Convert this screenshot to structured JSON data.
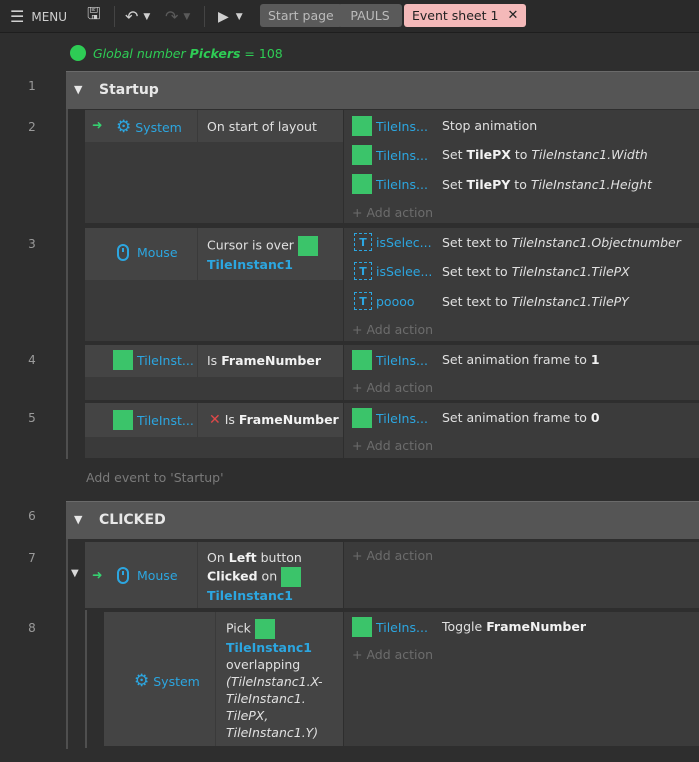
{
  "toolbar": {
    "menu": "MENU",
    "tabs": [
      "Start page",
      "PAULS",
      "Event sheet 1"
    ]
  },
  "global_var": {
    "prefix": "Global number",
    "name": "Pickers",
    "value": "= 108"
  },
  "rows": [
    "1",
    "2",
    "3",
    "4",
    "5",
    "6",
    "7",
    "8"
  ],
  "groups": {
    "g1": "Startup",
    "g2": "CLICKED"
  },
  "events": {
    "e2": {
      "obj": "System",
      "cond": "On start of layout",
      "a": [
        {
          "obj": "TileIns...",
          "text": "Stop animation"
        },
        {
          "obj": "TileIns...",
          "pre": "Set",
          "prop": "TilePX",
          "mid": "to",
          "expr": "TileInstanc1.Width"
        },
        {
          "obj": "TileIns...",
          "pre": "Set",
          "prop": "TilePY",
          "mid": "to",
          "expr": "TileInstanc1.Height"
        }
      ]
    },
    "e3": {
      "obj": "Mouse",
      "cond": "Cursor is over",
      "target": "TileInstanc1",
      "a": [
        {
          "obj": "isSelec...",
          "pre": "Set text to",
          "expr": "TileInstanc1.Objectnumber"
        },
        {
          "obj": "isSelee...",
          "pre": "Set text to",
          "expr": "TileInstanc1.TilePX"
        },
        {
          "obj": "poooo",
          "pre": "Set text to",
          "expr": "TileInstanc1.TilePY"
        }
      ]
    },
    "e4": {
      "obj": "TileInst...",
      "pre": "Is",
      "prop": "FrameNumber",
      "a": [
        {
          "obj": "TileIns...",
          "pre": "Set animation frame to",
          "val": "1"
        }
      ]
    },
    "e5": {
      "obj": "TileInst...",
      "pre": "Is",
      "prop": "FrameNumber",
      "a": [
        {
          "obj": "TileIns...",
          "pre": "Set animation frame to",
          "val": "0"
        }
      ]
    },
    "e7": {
      "obj": "Mouse",
      "l1a": "On",
      "l1b": "Left",
      "l1c": "button",
      "l2a": "Clicked",
      "l2b": "on",
      "target": "TileInstanc1"
    },
    "e8": {
      "obj": "System",
      "pick": "Pick",
      "target": "TileInstanc1",
      "w": "overlapping",
      "exprs": [
        "(TileInstanc1.X-",
        "TileInstanc1.",
        "TilePX,",
        "TileInstanc1.Y)"
      ],
      "a": [
        {
          "obj": "TileIns...",
          "pre": "Toggle",
          "prop": "FrameNumber"
        }
      ]
    }
  },
  "add_action": "Add action",
  "add_event": "Add event to 'Startup'",
  "colors": {
    "accent": "#2ca6e0",
    "sprite": "#3bc46a",
    "var": "#2ecc55",
    "active_tab": "#f4b9b9"
  }
}
